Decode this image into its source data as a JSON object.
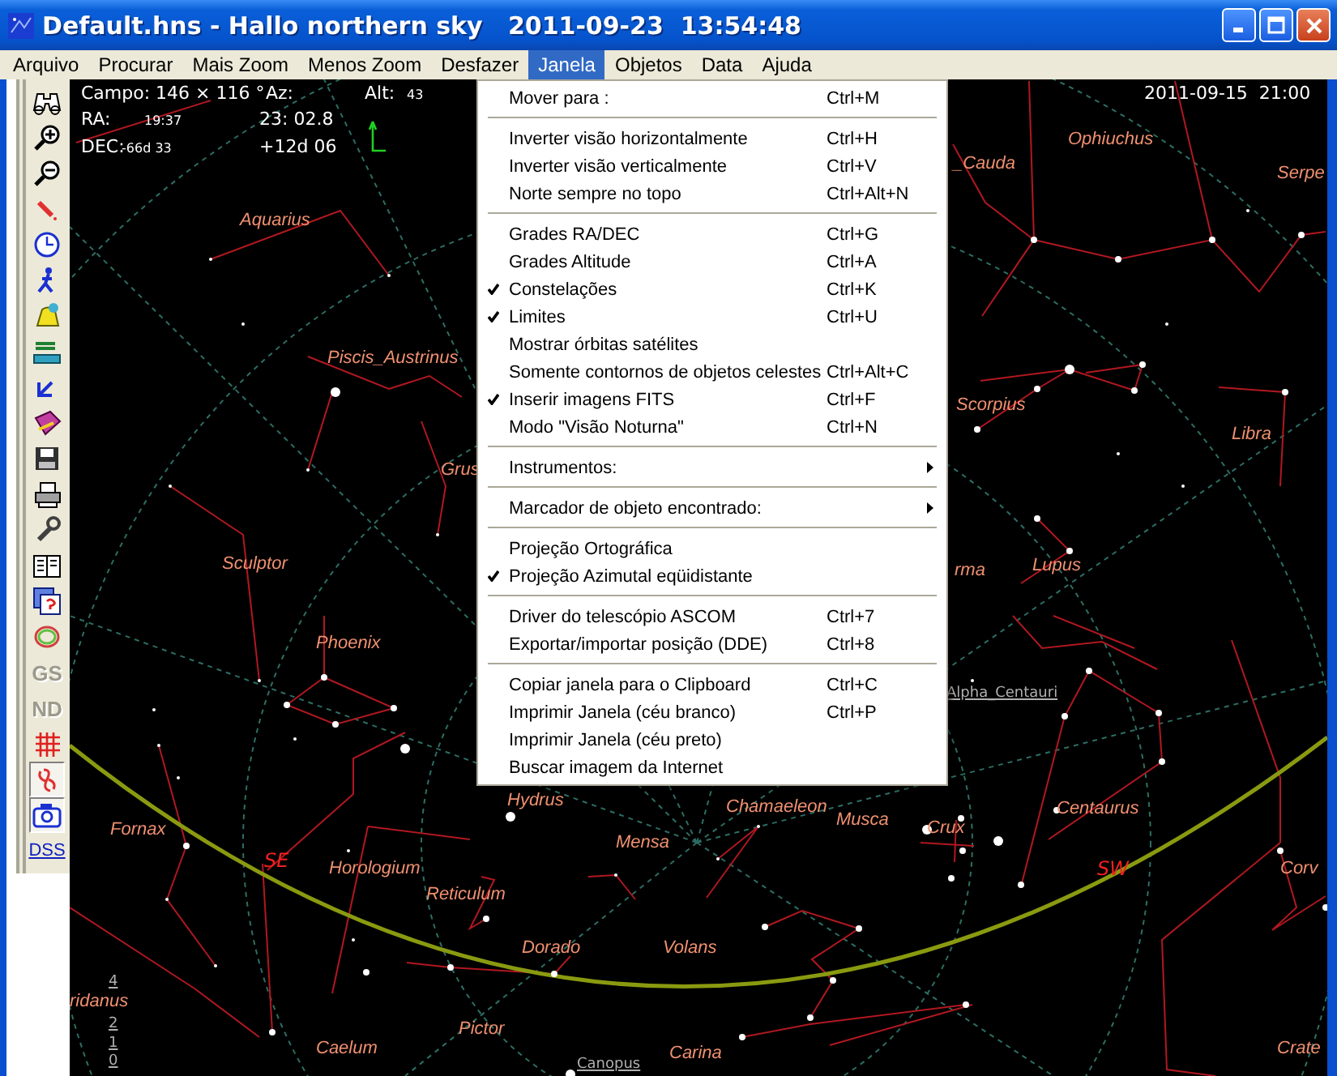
{
  "window": {
    "title": "Default.hns - Hallo northern sky   2011-09-23  13:54:48"
  },
  "menu_bar": [
    {
      "label": "Arquivo",
      "selected": false
    },
    {
      "label": "Procurar",
      "selected": false
    },
    {
      "label": "Mais Zoom",
      "selected": false
    },
    {
      "label": "Menos Zoom",
      "selected": false
    },
    {
      "label": "Desfazer",
      "selected": false
    },
    {
      "label": "Janela",
      "selected": true
    },
    {
      "label": "Objetos",
      "selected": false
    },
    {
      "label": "Data",
      "selected": false
    },
    {
      "label": "Ajuda",
      "selected": false
    }
  ],
  "toolbar": [
    {
      "kind": "icon",
      "pressed": false,
      "disabled": false
    },
    {
      "kind": "icon",
      "pressed": false,
      "disabled": false
    },
    {
      "kind": "icon",
      "pressed": false,
      "disabled": false
    },
    {
      "kind": "icon",
      "pressed": false,
      "disabled": false
    },
    {
      "kind": "icon",
      "pressed": false,
      "disabled": false
    },
    {
      "kind": "icon",
      "pressed": false,
      "disabled": false
    },
    {
      "kind": "icon",
      "pressed": false,
      "disabled": false
    },
    {
      "kind": "icon",
      "pressed": false,
      "disabled": false
    },
    {
      "kind": "icon",
      "pressed": false,
      "disabled": false
    },
    {
      "kind": "icon",
      "pressed": false,
      "disabled": false
    },
    {
      "kind": "icon",
      "pressed": false,
      "disabled": false
    },
    {
      "kind": "icon",
      "pressed": false,
      "disabled": false
    },
    {
      "kind": "icon",
      "pressed": false,
      "disabled": false
    },
    {
      "kind": "icon",
      "pressed": false,
      "disabled": false
    },
    {
      "kind": "icon",
      "pressed": false,
      "disabled": false
    },
    {
      "kind": "icon",
      "pressed": false,
      "disabled": false
    },
    {
      "kind": "text",
      "label": "GS",
      "pressed": false,
      "disabled": true
    },
    {
      "kind": "text",
      "label": "ND",
      "pressed": false,
      "disabled": true
    },
    {
      "kind": "icon",
      "pressed": false,
      "disabled": false
    },
    {
      "kind": "icon",
      "pressed": true,
      "disabled": false
    },
    {
      "kind": "icon",
      "pressed": true,
      "disabled": false
    },
    {
      "kind": "link",
      "label": "DSS",
      "pressed": false,
      "disabled": false
    }
  ],
  "info_panel": {
    "field_label": "Campo:",
    "field_value": "146 × 116 °",
    "az_label": "Az:",
    "alt_label": "Alt:",
    "alt_value": "43",
    "ra_label": "RA:",
    "ra_cursor": "19:37",
    "ra_value": "23: 02.8",
    "dec_label": "DEC:",
    "dec_cursor": "-66d 33",
    "dec_value": "+12d 06"
  },
  "map_datetime": "2011-09-15  21:00",
  "constellations": [
    "Aquarius",
    "Piscis_Austrinus",
    "Grus",
    "Sculptor",
    "Phoenix",
    "Fornax",
    "Horologium",
    "Reticulum",
    "Dorado",
    "Volans",
    "Mensa",
    "Hydrus",
    "Chamaeleon",
    "Musca",
    "Crux",
    "Centaurus",
    "Caelum",
    "Pictor",
    "Carina",
    "ridanus",
    "_Cauda",
    "Ophiuchus",
    "Serpe",
    "Scorpius",
    "Libra",
    "rma",
    "Lupus",
    "Corv",
    "Crate"
  ],
  "directions": [
    "SE",
    "SW"
  ],
  "star_labels": [
    "Alpha_Centauri",
    "Canopus"
  ],
  "magnitude_legend": [
    "4",
    "2",
    "1",
    "0"
  ],
  "dropdown_menu": [
    {
      "kind": "item",
      "label": "Mover para :",
      "shortcut": "Ctrl+M",
      "checked": false
    },
    {
      "kind": "separator"
    },
    {
      "kind": "item",
      "label": "Inverter visão horizontalmente",
      "shortcut": "Ctrl+H",
      "checked": false
    },
    {
      "kind": "item",
      "label": "Inverter visão verticalmente",
      "shortcut": "Ctrl+V",
      "checked": false
    },
    {
      "kind": "item",
      "label": "Norte sempre no topo",
      "shortcut": "Ctrl+Alt+N",
      "checked": false
    },
    {
      "kind": "separator"
    },
    {
      "kind": "item",
      "label": "Grades RA/DEC",
      "shortcut": "Ctrl+G",
      "checked": false
    },
    {
      "kind": "item",
      "label": "Grades Altitude",
      "shortcut": "Ctrl+A",
      "checked": false
    },
    {
      "kind": "item",
      "label": "Constelações",
      "shortcut": "Ctrl+K",
      "checked": true
    },
    {
      "kind": "item",
      "label": "Limites",
      "shortcut": "Ctrl+U",
      "checked": true
    },
    {
      "kind": "item",
      "label": "Mostrar órbitas satélites",
      "checked": false
    },
    {
      "kind": "item",
      "label": "Somente contornos de objetos celestes",
      "shortcut": "Ctrl+Alt+C",
      "checked": false
    },
    {
      "kind": "item",
      "label": "Inserir imagens FITS",
      "shortcut": "Ctrl+F",
      "checked": true
    },
    {
      "kind": "item",
      "label": "Modo \"Visão Noturna\"",
      "shortcut": "Ctrl+N",
      "checked": false
    },
    {
      "kind": "separator"
    },
    {
      "kind": "submenu",
      "label": "Instrumentos:",
      "checked": false
    },
    {
      "kind": "separator"
    },
    {
      "kind": "submenu",
      "label": "Marcador de objeto encontrado:",
      "checked": false
    },
    {
      "kind": "separator"
    },
    {
      "kind": "item",
      "label": "Projeção Ortográfica",
      "checked": false
    },
    {
      "kind": "item",
      "label": "Projeção Azimutal eqüidistante",
      "checked": true
    },
    {
      "kind": "separator"
    },
    {
      "kind": "item",
      "label": "Driver do telescópio ASCOM",
      "shortcut": "Ctrl+7",
      "checked": false
    },
    {
      "kind": "item",
      "label": "Exportar/importar posição (DDE)",
      "shortcut": "Ctrl+8",
      "checked": false
    },
    {
      "kind": "separator"
    },
    {
      "kind": "item",
      "label": "Copiar janela para o Clipboard",
      "shortcut": "Ctrl+C",
      "checked": false
    },
    {
      "kind": "item",
      "label": "Imprimir Janela (céu branco)",
      "shortcut": "Ctrl+P",
      "checked": false
    },
    {
      "kind": "item",
      "label": "Imprimir Janela (céu preto)",
      "checked": false
    },
    {
      "kind": "item",
      "label": "Buscar imagem da Internet",
      "checked": false
    }
  ]
}
